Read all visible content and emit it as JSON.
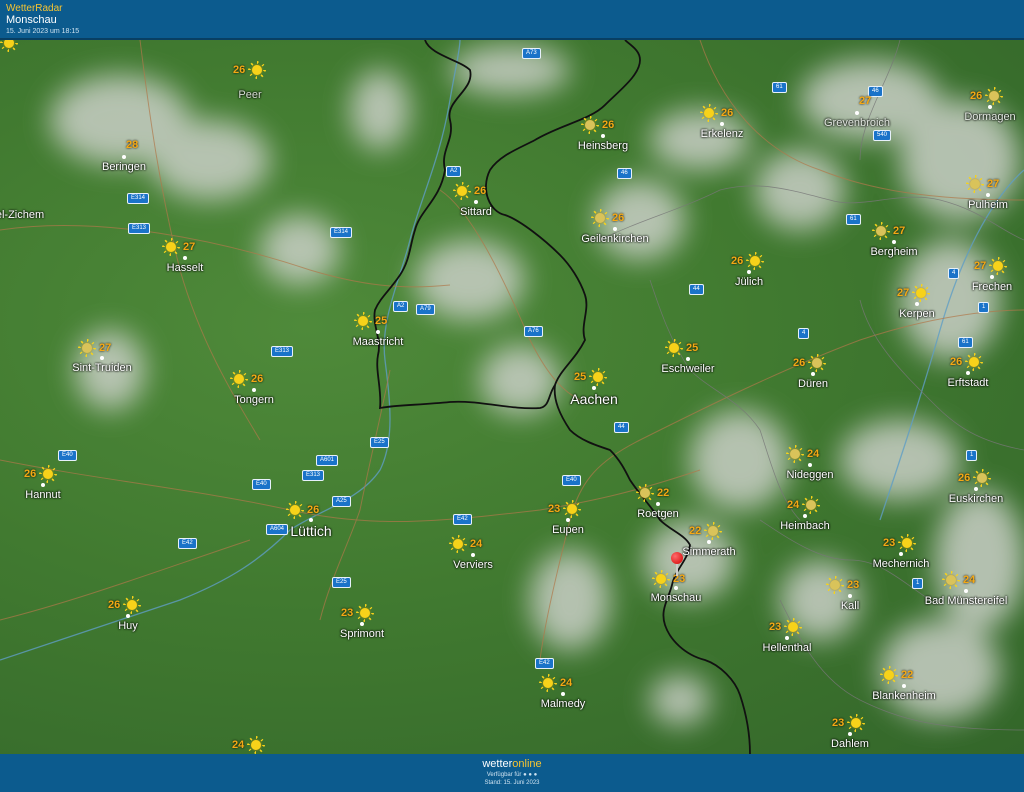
{
  "header": {
    "brand": "WetterRadar",
    "location": "Monschau",
    "timestamp": "15. Juni 2023 um 18:15"
  },
  "footer": {
    "logo_a": "wetter",
    "logo_b": "online",
    "available": "Verfügbar für ● ● ●",
    "stand": "Stand: 15. Juni 2023"
  },
  "places": [
    {
      "name": "Peer",
      "temp": "26"
    },
    {
      "name": "Beringen",
      "temp": "28"
    },
    {
      "name": "el-Zichem",
      "temp": ""
    },
    {
      "name": "Hasselt",
      "temp": "27"
    },
    {
      "name": "Sint-Truiden",
      "temp": "27"
    },
    {
      "name": "Tongern",
      "temp": "26"
    },
    {
      "name": "Hannut",
      "temp": "26"
    },
    {
      "name": "Lüttich",
      "temp": "26"
    },
    {
      "name": "Huy",
      "temp": "26"
    },
    {
      "name": "Sprimont",
      "temp": "23"
    },
    {
      "name": "Verviers",
      "temp": "24"
    },
    {
      "name": "Eupen",
      "temp": "23"
    },
    {
      "name": "Malmedy",
      "temp": "24"
    },
    {
      "name": "Maastricht",
      "temp": "25"
    },
    {
      "name": "Sittard",
      "temp": "26"
    },
    {
      "name": "Heinsberg",
      "temp": "26"
    },
    {
      "name": "Erkelenz",
      "temp": "26"
    },
    {
      "name": "Geilenkirchen",
      "temp": "26"
    },
    {
      "name": "Jülich",
      "temp": "26"
    },
    {
      "name": "Aachen",
      "temp": "25"
    },
    {
      "name": "Eschweiler",
      "temp": "25"
    },
    {
      "name": "Düren",
      "temp": "26"
    },
    {
      "name": "Roetgen",
      "temp": "22"
    },
    {
      "name": "Simmerath",
      "temp": "22"
    },
    {
      "name": "Monschau",
      "temp": "23"
    },
    {
      "name": "Nideggen",
      "temp": "24"
    },
    {
      "name": "Heimbach",
      "temp": "24"
    },
    {
      "name": "Hellenthal",
      "temp": "23"
    },
    {
      "name": "Kall",
      "temp": "23"
    },
    {
      "name": "Mechernich",
      "temp": "23"
    },
    {
      "name": "Blankenheim",
      "temp": "22"
    },
    {
      "name": "Dahlem",
      "temp": "23"
    },
    {
      "name": "Bad Münstereifel",
      "temp": "24"
    },
    {
      "name": "Euskirchen",
      "temp": "26"
    },
    {
      "name": "Erftstadt",
      "temp": "26"
    },
    {
      "name": "Kerpen",
      "temp": "27"
    },
    {
      "name": "Frechen",
      "temp": "27"
    },
    {
      "name": "Bergheim",
      "temp": "27"
    },
    {
      "name": "Pulheim",
      "temp": "27"
    },
    {
      "name": "Grevenbroich",
      "temp": "27"
    },
    {
      "name": "Dormagen",
      "temp": "26"
    },
    {
      "name": "",
      "temp": "24"
    }
  ],
  "roads": [
    "A73",
    "61",
    "46",
    "A2",
    "E314",
    "E313",
    "46",
    "540",
    "E314",
    "61",
    "A2",
    "A79",
    "44",
    "A76",
    "4",
    "E313",
    "1",
    "4",
    "61",
    "E25",
    "44",
    "A601",
    "E313",
    "E40",
    "E40",
    "A25",
    "E40",
    "E42",
    "A604",
    "E42",
    "E25",
    "1",
    "E42",
    "1"
  ],
  "marker": {
    "label": "Monschau"
  }
}
